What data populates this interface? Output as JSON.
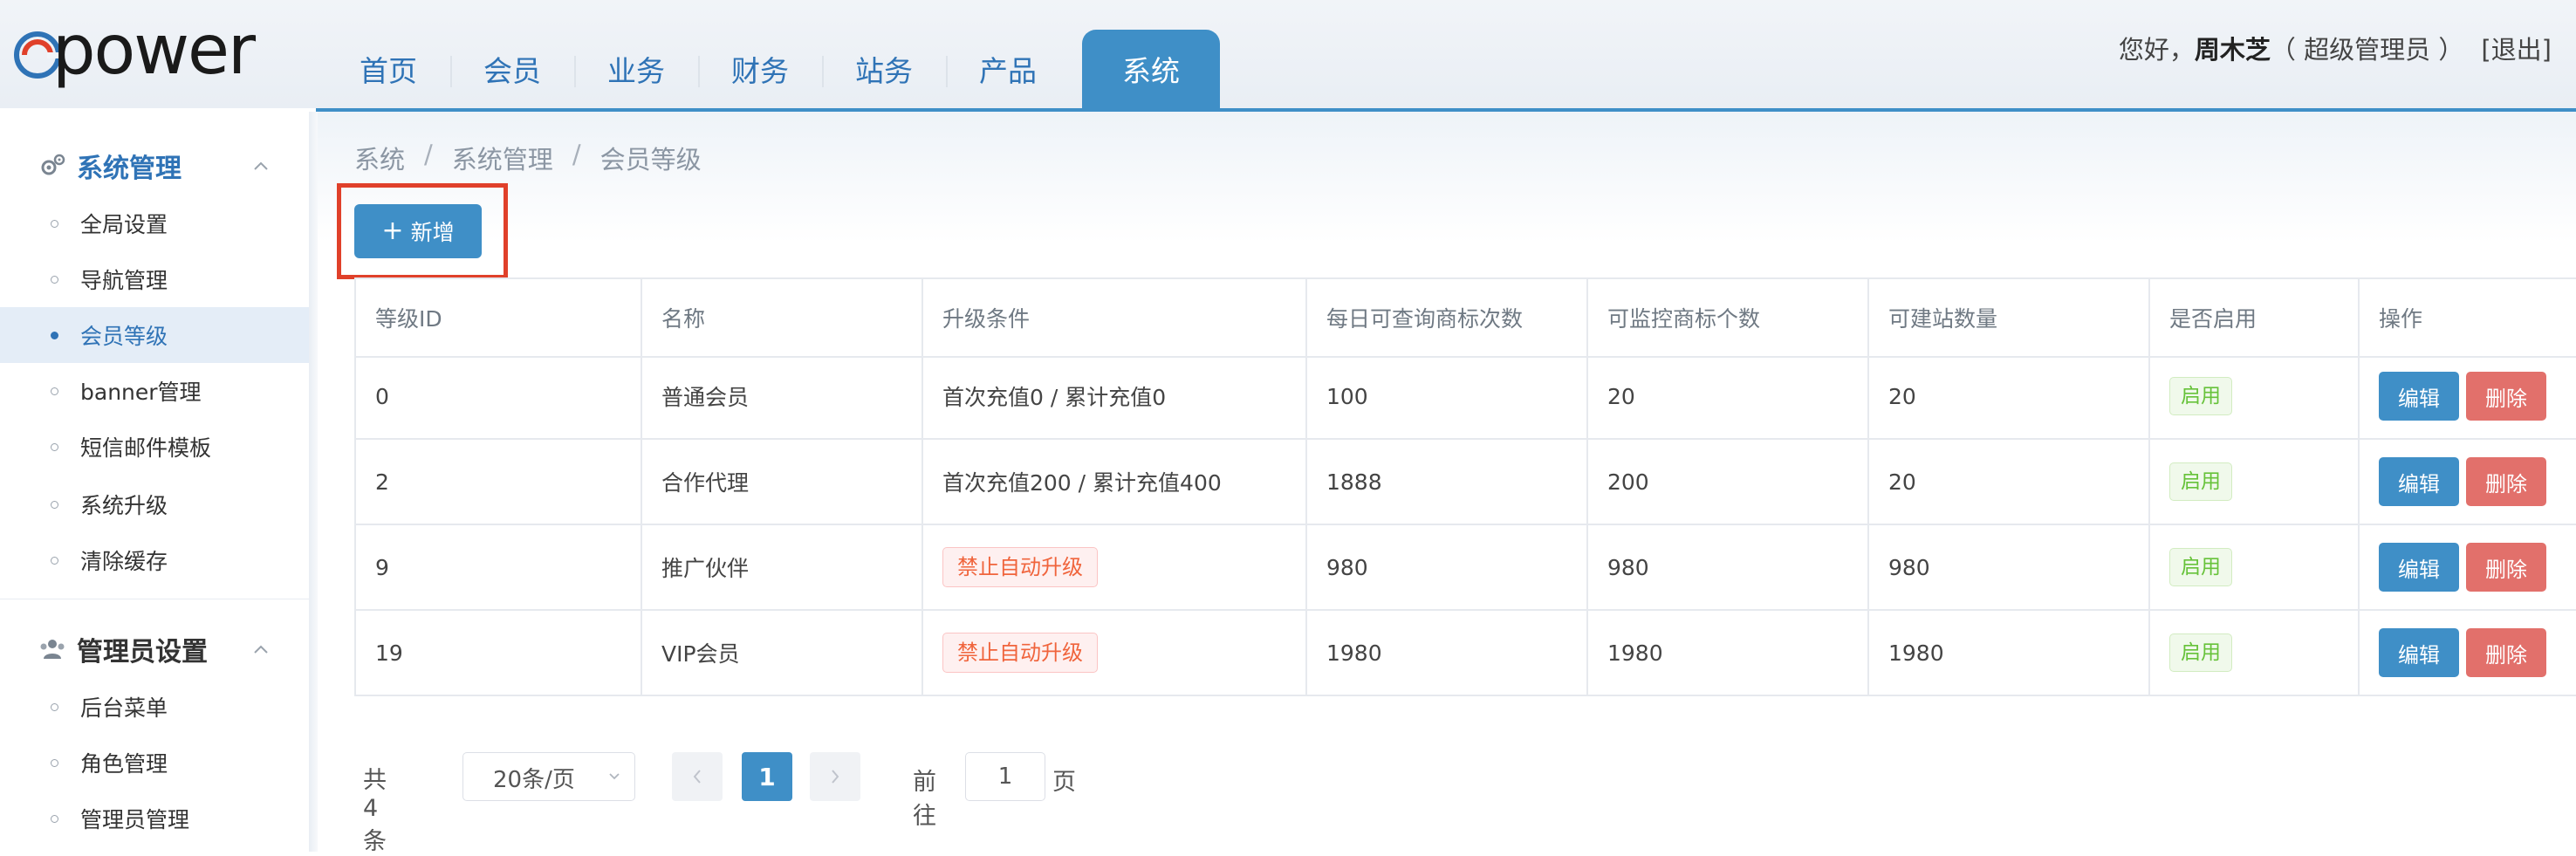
{
  "app": {
    "logo_text": "power"
  },
  "nav": {
    "items": [
      "首页",
      "会员",
      "业务",
      "财务",
      "站务",
      "产品",
      "系统"
    ],
    "active_index": 6
  },
  "user": {
    "greeting": "您好，",
    "name": "周木芝",
    "role": "（ 超级管理员 ）",
    "logout": "[退出]"
  },
  "sidebar": {
    "groups": [
      {
        "title": "系统管理",
        "icon": "gears-icon",
        "expanded": true,
        "items": [
          "全局设置",
          "导航管理",
          "会员等级",
          "banner管理",
          "短信邮件模板",
          "系统升级",
          "清除缓存"
        ]
      },
      {
        "title": "管理员设置",
        "icon": "users-icon",
        "expanded": true,
        "items": [
          "后台菜单",
          "角色管理",
          "管理员管理"
        ]
      }
    ],
    "active_item": "会员等级"
  },
  "breadcrumb": [
    "系统",
    "系统管理",
    "会员等级"
  ],
  "toolbar": {
    "add_label": "新增"
  },
  "table": {
    "headers": [
      "等级ID",
      "名称",
      "升级条件",
      "每日可查询商标次数",
      "可监控商标个数",
      "可建站数量",
      "是否启用",
      "操作"
    ],
    "rows": [
      {
        "id": "0",
        "name": "普通会员",
        "condition": "首次充值0 / 累计充值0",
        "condition_disabled": false,
        "queries": "100",
        "monitors": "20",
        "sites": "20",
        "status": "启用"
      },
      {
        "id": "2",
        "name": "合作代理",
        "condition": "首次充值200 / 累计充值400",
        "condition_disabled": false,
        "queries": "1888",
        "monitors": "200",
        "sites": "20",
        "status": "启用"
      },
      {
        "id": "9",
        "name": "推广伙伴",
        "condition": "禁止自动升级",
        "condition_disabled": true,
        "queries": "980",
        "monitors": "980",
        "sites": "980",
        "status": "启用"
      },
      {
        "id": "19",
        "name": "VIP会员",
        "condition": "禁止自动升级",
        "condition_disabled": true,
        "queries": "1980",
        "monitors": "1980",
        "sites": "1980",
        "status": "启用"
      }
    ],
    "edit_label": "编辑",
    "delete_label": "删除"
  },
  "pagination": {
    "total": "共 4 条",
    "page_size": "20条/页",
    "current_page": "1",
    "goto_prefix": "前往",
    "goto_value": "1",
    "goto_suffix": "页"
  },
  "colors": {
    "primary": "#3f8fc7",
    "danger": "#e2706b",
    "success": "#67c23a",
    "highlight": "#e0402a"
  }
}
